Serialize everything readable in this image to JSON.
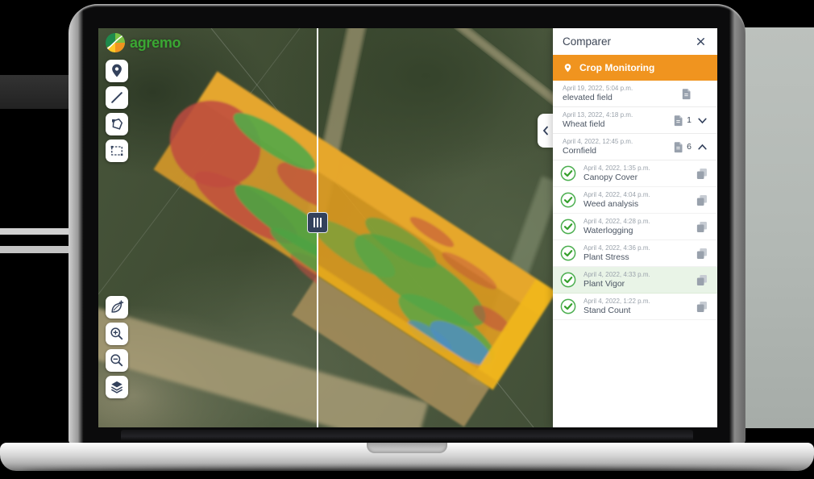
{
  "brand": {
    "name": "agremo"
  },
  "map": {
    "tools_top": [
      "location-pin",
      "measure-line",
      "draw-polygon",
      "select-rectangle"
    ],
    "tools_bottom": [
      "leaf-add",
      "zoom-in",
      "zoom-out",
      "layers"
    ]
  },
  "panel": {
    "title": "Comparer",
    "section_label": "Crop Monitoring",
    "fields": [
      {
        "date": "April 19, 2022, 5:04 p.m.",
        "name": "elevated field"
      },
      {
        "date": "April 13, 2022, 4:18 p.m.",
        "name": "Wheat field",
        "count": "1",
        "state": "collapsed"
      },
      {
        "date": "April 4, 2022, 12:45 p.m.",
        "name": "Cornfield",
        "count": "6",
        "state": "expanded"
      }
    ],
    "analyses": [
      {
        "date": "April 4, 2022, 1:35 p.m.",
        "name": "Canopy Cover"
      },
      {
        "date": "April 4, 2022, 4:04 p.m.",
        "name": "Weed analysis"
      },
      {
        "date": "April 4, 2022, 4:28 p.m.",
        "name": "Waterlogging"
      },
      {
        "date": "April 4, 2022, 4:36 p.m.",
        "name": "Plant Stress"
      },
      {
        "date": "April 4, 2022, 4:33 p.m.",
        "name": "Plant Vigor"
      },
      {
        "date": "April 4, 2022, 1:22 p.m.",
        "name": "Stand Count"
      }
    ],
    "selected_analysis": "Plant Vigor"
  },
  "colors": {
    "accent_orange": "#F0941F",
    "icon_navy": "#33415C",
    "check_green": "#43A047",
    "selected_row_bg": "#E9F4E7",
    "logo_green": "#3AA733"
  }
}
